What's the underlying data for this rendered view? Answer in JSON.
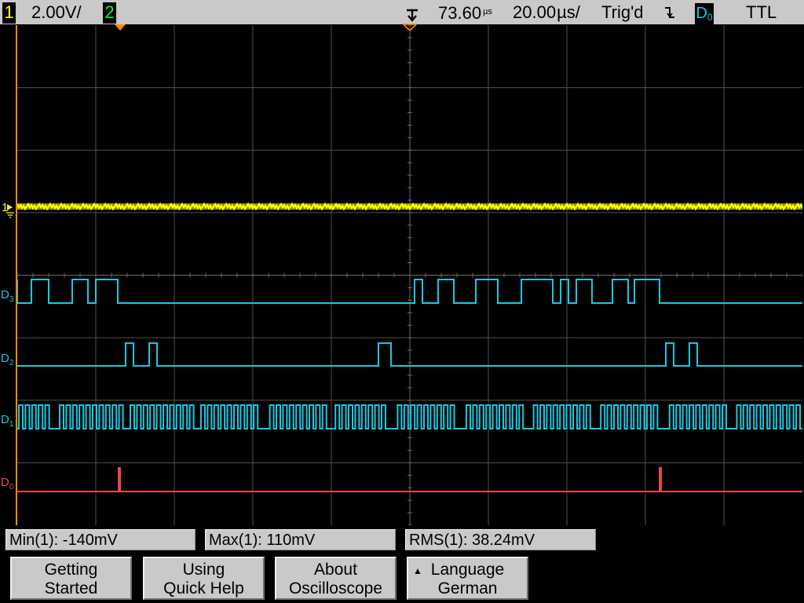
{
  "status_bar": {
    "ch1_badge": "1",
    "ch1_scale": "2.00V/",
    "ch2_badge": "2",
    "delay_value": "73.60",
    "delay_unit": "µs",
    "timebase_value": "20.00",
    "timebase_unit": "µs/",
    "trigger_status": "Trig'd",
    "trigger_slope_symbol": "⌇",
    "trigger_source": "D",
    "trigger_source_sub": "0",
    "trigger_threshold": "TTL"
  },
  "channel_labels": {
    "ch1": "1",
    "d3": "D",
    "d3_sub": "3",
    "d2": "D",
    "d2_sub": "2",
    "d1": "D",
    "d1_sub": "1",
    "d0": "D",
    "d0_sub": "0"
  },
  "measurements": [
    {
      "label": "Min(1): -140mV"
    },
    {
      "label": "Max(1): 110mV"
    },
    {
      "label": "RMS(1): 38.24mV"
    }
  ],
  "softkeys": [
    {
      "line1": "Getting",
      "line2": "Started"
    },
    {
      "line1": "Using",
      "line2": "Quick Help"
    },
    {
      "line1": "About",
      "line2": "Oscilloscope"
    },
    {
      "line1": "Language",
      "line2": "German",
      "indicator": "▲"
    }
  ],
  "colors": {
    "ch1": "#ffff00",
    "ch2": "#00ff3a",
    "digital": "#18c9e0",
    "d0": "#e84848",
    "marker": "#ff8c00",
    "grid": "#505050"
  },
  "icons": {
    "trigger_position": "trigger-position-marker-icon",
    "ground": "ground-marker-icon"
  }
}
